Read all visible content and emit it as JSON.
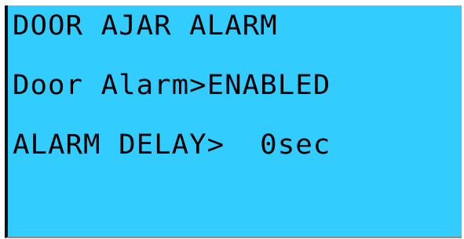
{
  "display": {
    "background_color": "#33ccff",
    "text_color": "#000000",
    "lines": [
      "DOOR AJAR ALARM",
      "Door Alarm>ENABLED",
      "ALARM DELAY>  0sec",
      ""
    ]
  }
}
